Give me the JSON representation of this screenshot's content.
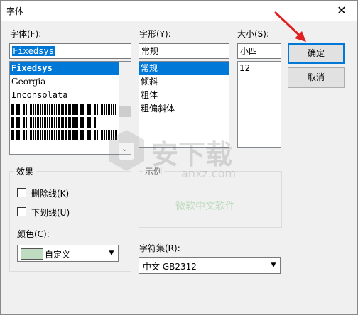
{
  "window": {
    "title": "字体",
    "close_glyph": "✕"
  },
  "font": {
    "label": "字体(F):",
    "value": "Fixedsys",
    "items": [
      "Fixedsys",
      "Georgia",
      "Inconsolata"
    ],
    "scroll_down_glyph": "⌄"
  },
  "style": {
    "label": "字形(Y):",
    "value": "常规",
    "items": [
      "常规",
      "倾斜",
      "粗体",
      "粗偏斜体"
    ]
  },
  "size": {
    "label": "大小(S):",
    "value": "小四",
    "items": [
      "12"
    ]
  },
  "buttons": {
    "ok": "确定",
    "cancel": "取消"
  },
  "effects": {
    "title": "效果",
    "strikeout": "删除线(K)",
    "underline": "下划线(U)",
    "color_label": "颜色(C):",
    "color_value": "自定义",
    "color_swatch": "#c0dcc0"
  },
  "sample": {
    "title": "示例",
    "text": "微软中文软件",
    "text_color": "#c0dcc0"
  },
  "charset": {
    "label": "字符集(R):",
    "value": "中文 GB2312"
  },
  "annotation": {
    "arrow_color": "#e02020"
  },
  "watermark": {
    "site": "安下载",
    "domain": "anxz.com"
  }
}
